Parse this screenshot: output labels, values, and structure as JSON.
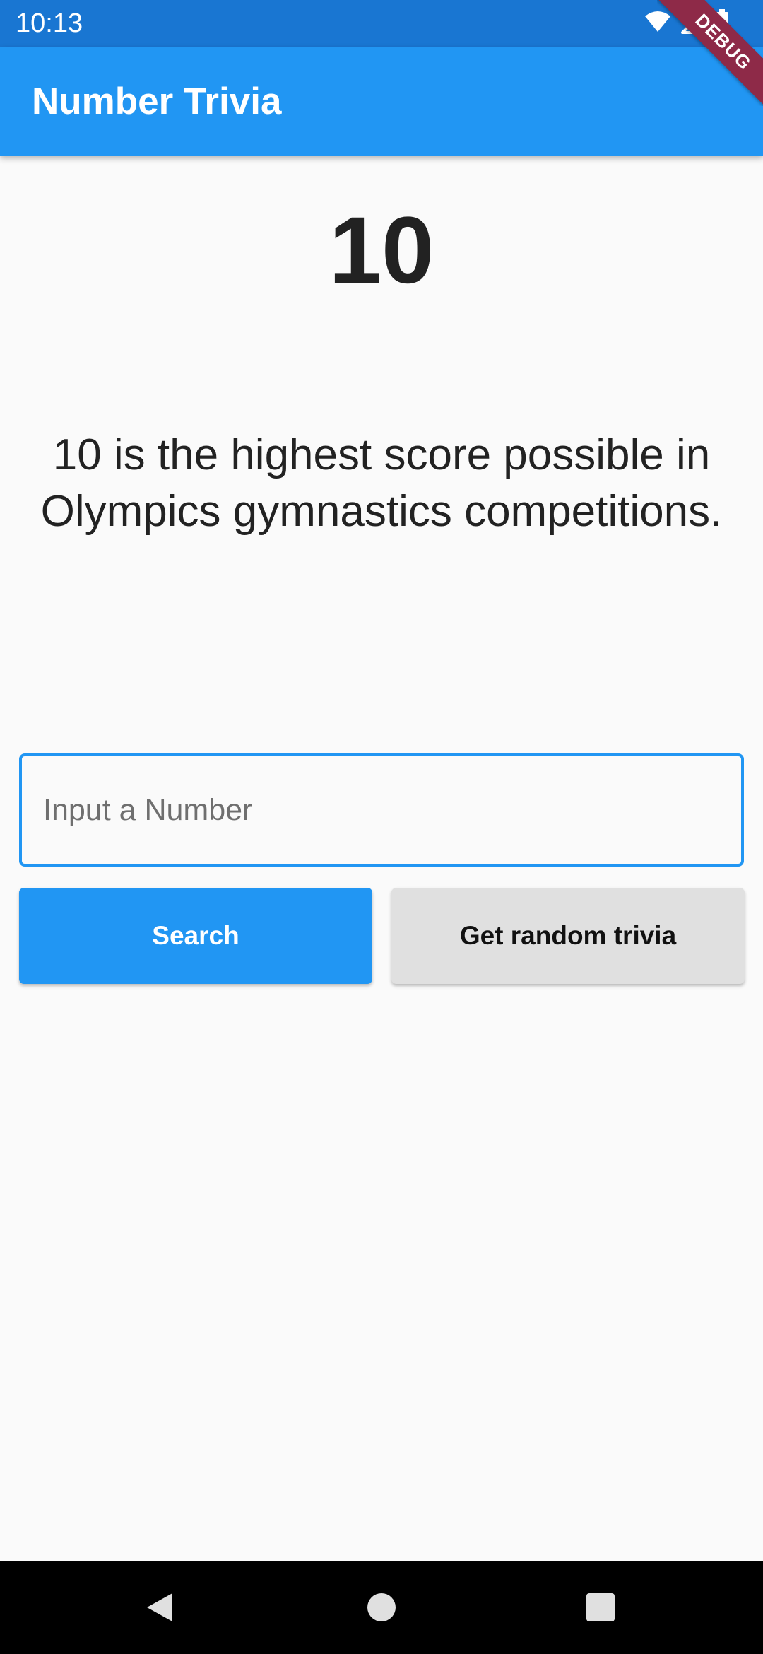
{
  "status_bar": {
    "time": "10:13",
    "icons": [
      "wifi-icon",
      "signal-icon",
      "battery-icon"
    ]
  },
  "debug_banner": {
    "label": "DEBUG"
  },
  "app_bar": {
    "title": "Number Trivia"
  },
  "trivia": {
    "number": "10",
    "text": "10 is the highest score possible in Olympics gymnastics competitions."
  },
  "input": {
    "value": "",
    "placeholder": "Input a Number"
  },
  "buttons": {
    "search_label": "Search",
    "random_label": "Get random trivia"
  },
  "nav_bar": {
    "icons": [
      "back-icon",
      "home-icon",
      "recents-icon"
    ]
  },
  "colors": {
    "status_bar": "#1976d2",
    "app_bar": "#2196f3",
    "accent": "#2196f3",
    "secondary_button": "#e0e0e0",
    "background": "#fafafa",
    "debug_ribbon": "#8e2a48"
  }
}
